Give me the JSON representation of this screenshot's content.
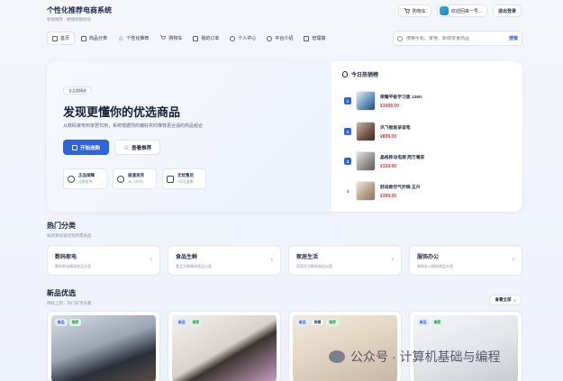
{
  "header": {
    "title": "个性化推荐电商系统",
    "subtitle": "智能推荐 · 便捷购物体验",
    "cart_label": "购物车",
    "user_label": "欢迎回来一号...",
    "logout_label": "退出登录"
  },
  "nav": {
    "items": [
      {
        "label": "首页",
        "icon": "home-icon"
      },
      {
        "label": "商品分类",
        "icon": "grid-icon"
      },
      {
        "label": "个性化推荐",
        "icon": "star-icon"
      },
      {
        "label": "购物车",
        "icon": "cart-icon"
      },
      {
        "label": "我的订单",
        "icon": "document-icon"
      },
      {
        "label": "个人中心",
        "icon": "user-icon"
      },
      {
        "label": "平台介绍",
        "icon": "info-icon"
      },
      {
        "label": "管理端",
        "icon": "shield-icon"
      }
    ],
    "search_placeholder": "搜索手机、家电、新鲜零食商品",
    "search_button": "搜索"
  },
  "hero": {
    "tag": "全品类精选",
    "title": "发现更懂你的优选商品",
    "subtitle": "从数码家电到家居日用，系统根据你的偏好实时推荐更合适的商品组合",
    "primary_button": "开始选购",
    "secondary_button": "查看推荐",
    "features": [
      {
        "title": "正品保障",
        "sub": "品牌直供",
        "icon": "shield-icon"
      },
      {
        "title": "极速发货",
        "sub": "48 小时内",
        "icon": "clock-icon"
      },
      {
        "title": "无忧售后",
        "sub": "7天可退换",
        "icon": "thumbs-up-icon"
      }
    ]
  },
  "hot": {
    "title": "今日热销榜",
    "items": [
      {
        "rank": "1",
        "name": "荣耀平板学习版 128G",
        "price": "¥1499.00",
        "color": "#5a8fb8"
      },
      {
        "rank": "2",
        "name": "讯飞智能录音笔",
        "price": "¥899.00",
        "color": "#7b5b4c"
      },
      {
        "rank": "3",
        "name": "晶格移动电源 两万毫安",
        "price": "¥139.00",
        "color": "#9a9590"
      },
      {
        "rank": "4",
        "name": "舒适款空气炸锅 五升",
        "price": "¥399.00",
        "color": "#b8a288"
      }
    ]
  },
  "categories": {
    "title": "热门分类",
    "subtitle": "按场景快速找到所需商品",
    "items": [
      {
        "name": "数码家电",
        "desc": "数码家电精选商品分类"
      },
      {
        "name": "食品生鲜",
        "desc": "食品生鲜精选商品分类"
      },
      {
        "name": "家居生活",
        "desc": "家居生活精选商品分类"
      },
      {
        "name": "服饰办公",
        "desc": "服饰办公精选商品分类"
      }
    ]
  },
  "new_products": {
    "title": "新品优选",
    "subtitle": "持续上新，热门好货先看",
    "view_all": "查看全部",
    "items": [
      {
        "badges": [
          "新品",
          "推荐"
        ]
      },
      {
        "badges": [
          "新品",
          "推荐"
        ]
      },
      {
        "badges": [
          "新品",
          "热销",
          "推荐"
        ]
      },
      {
        "badges": [
          "新品",
          "推荐"
        ]
      }
    ]
  },
  "watermark": "公众号 · 计算机基础与编程",
  "colors": {
    "accent": "#2f63dc",
    "price": "#e0373a"
  }
}
